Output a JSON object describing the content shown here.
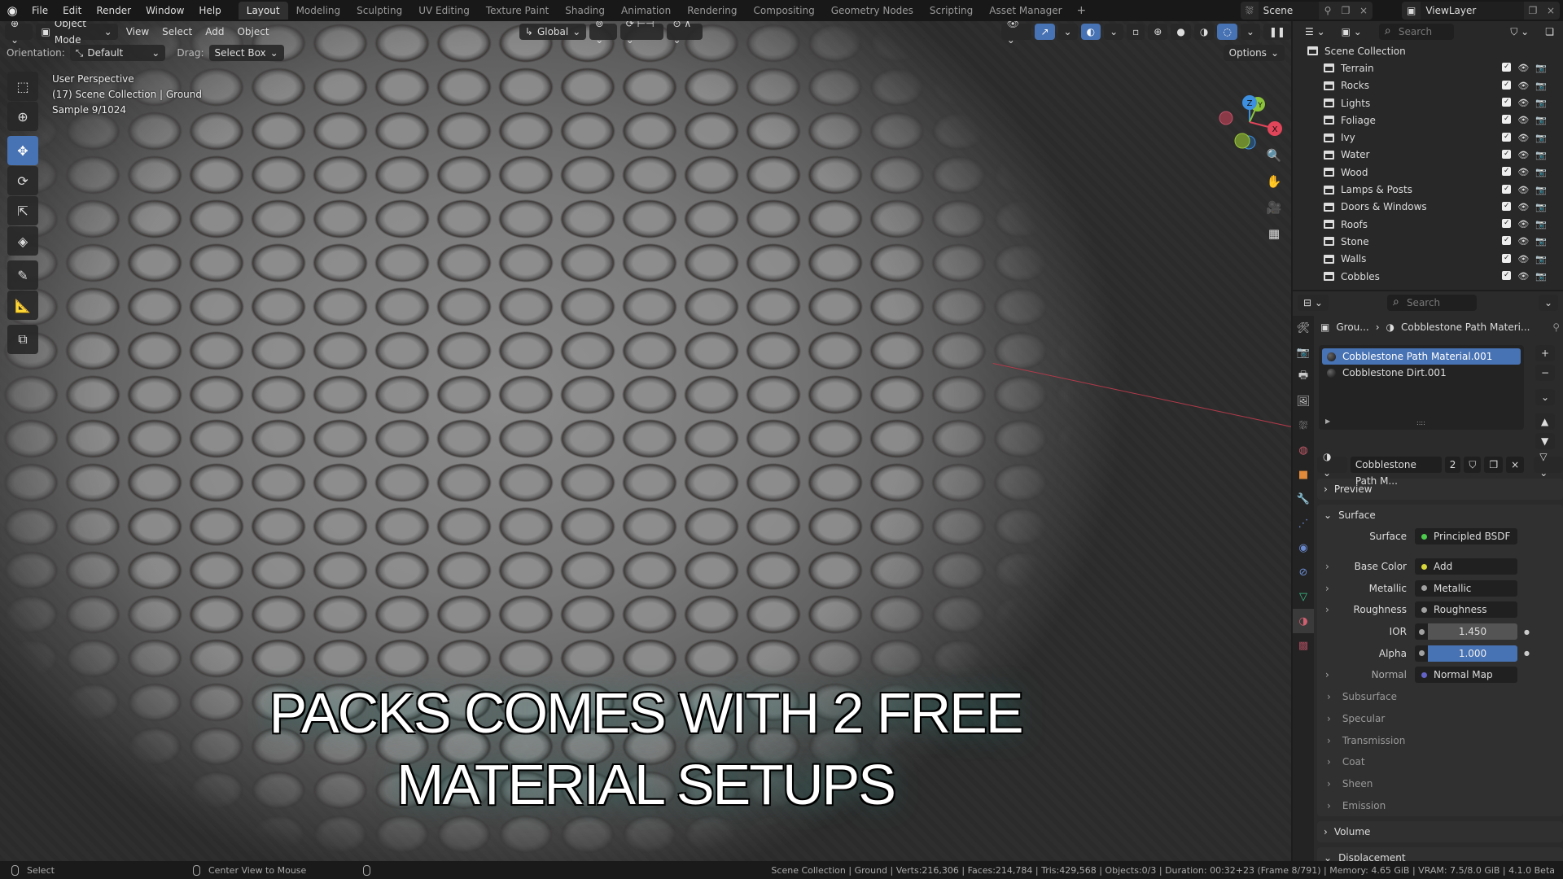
{
  "topbar": {
    "menus": [
      "File",
      "Edit",
      "Render",
      "Window",
      "Help"
    ],
    "workspaces": [
      "Layout",
      "Modeling",
      "Sculpting",
      "UV Editing",
      "Texture Paint",
      "Shading",
      "Animation",
      "Rendering",
      "Compositing",
      "Geometry Nodes",
      "Scripting",
      "Asset Manager"
    ],
    "active_workspace": "Layout",
    "add_workspace": "+",
    "scene": "Scene",
    "view_layer": "ViewLayer"
  },
  "viewport": {
    "mode": "Object Mode",
    "menus": [
      "View",
      "Select",
      "Add",
      "Object"
    ],
    "transform_orientation": "Global",
    "orientation_label": "Orientation:",
    "orientation_value": "Default",
    "drag_label": "Drag:",
    "drag_value": "Select Box",
    "options_label": "Options",
    "overlay_lines": [
      "User Perspective",
      "(17) Scene Collection | Ground",
      "Sample 9/1024"
    ],
    "gizmo_axes": {
      "x": "X",
      "y": "Y",
      "z": "Z"
    },
    "caption_line1": "PACKS COMES WITH 2 FREE",
    "caption_line2": "MATERIAL SETUPS"
  },
  "outliner": {
    "search_placeholder": "Search",
    "root": "Scene Collection",
    "collections": [
      "Terrain",
      "Rocks",
      "Lights",
      "Foliage",
      "Ivy",
      "Water",
      "Wood",
      "Lamps & Posts",
      "Doors & Windows",
      "Roofs",
      "Stone",
      "Walls",
      "Cobbles"
    ]
  },
  "properties": {
    "search_placeholder": "Search",
    "breadcrumb_object": "Grou...",
    "breadcrumb_material": "Cobblestone Path Materi...",
    "material_slots": [
      "Cobblestone Path Material.001",
      "Cobblestone Dirt.001"
    ],
    "selected_slot": 0,
    "material_name": "Cobblestone Path M...",
    "user_count": "2",
    "panels": {
      "preview": "Preview",
      "surface": "Surface",
      "volume": "Volume",
      "displacement": "Displacement"
    },
    "surface_rows": [
      {
        "label": "Surface",
        "value": "Principled BSDF",
        "socket_color": "#4ccc4c",
        "expand": false
      },
      {
        "label": "Base Color",
        "value": "Add",
        "socket_color": "#d6d63a",
        "expand": true
      },
      {
        "label": "Metallic",
        "value": "Metallic",
        "socket_color": "#a1a1a1",
        "expand": true
      },
      {
        "label": "Roughness",
        "value": "Roughness",
        "socket_color": "#a1a1a1",
        "expand": true
      }
    ],
    "ior": {
      "label": "IOR",
      "value": "1.450"
    },
    "alpha": {
      "label": "Alpha",
      "value": "1.000"
    },
    "normal": {
      "label": "Normal",
      "value": "Normal Map",
      "socket_color": "#6363c7"
    },
    "subpanels": [
      "Subsurface",
      "Specular",
      "Transmission",
      "Coat",
      "Sheen",
      "Emission"
    ]
  },
  "statusbar": {
    "left_action": "Select",
    "middle_action": "Center View to Mouse",
    "stats": "Scene Collection | Ground | Verts:216,306 | Faces:214,784 | Tris:429,568 | Objects:0/3 | Duration: 00:32+23 (Frame 8/791) | Memory: 4.65 GiB | VRAM: 7.5/8.0 GiB | 4.1.0 Beta"
  },
  "colors": {
    "accent": "#4772b3",
    "axis_x": "#e0455a",
    "axis_y": "#8bc43a",
    "axis_z": "#3d8fe0"
  }
}
